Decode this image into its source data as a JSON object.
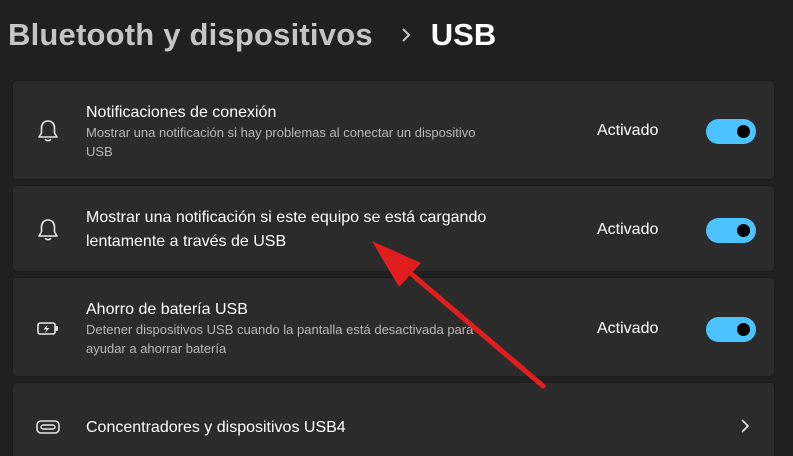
{
  "breadcrumb": {
    "parent": "Bluetooth y dispositivos",
    "current": "USB"
  },
  "settings": [
    {
      "title": "Notificaciones de conexión",
      "description_line1": "Mostrar una notificación si hay problemas al conectar un dispositivo",
      "description_line2": "USB",
      "status": "Activado",
      "toggle_on": true,
      "icon": "bell-icon"
    },
    {
      "title_line1": "Mostrar una notificación si este equipo se está cargando",
      "title_line2": "lentamente a través de USB",
      "status": "Activado",
      "toggle_on": true,
      "icon": "bell-icon"
    },
    {
      "title": "Ahorro de batería USB",
      "description_line1": "Detener dispositivos USB cuando la pantalla está desactivada para",
      "description_line2": "ayudar a ahorrar batería",
      "status": "Activado",
      "toggle_on": true,
      "icon": "battery-saver-icon"
    },
    {
      "title": "Concentradores y dispositivos USB4",
      "icon": "usb4-hub-icon",
      "action_icon": "chevron-right-icon"
    }
  ],
  "colors": {
    "background": "#202020",
    "card": "#2b2b2b",
    "accent": "#4cc2ff",
    "annotation_arrow": "#e01e1e"
  }
}
